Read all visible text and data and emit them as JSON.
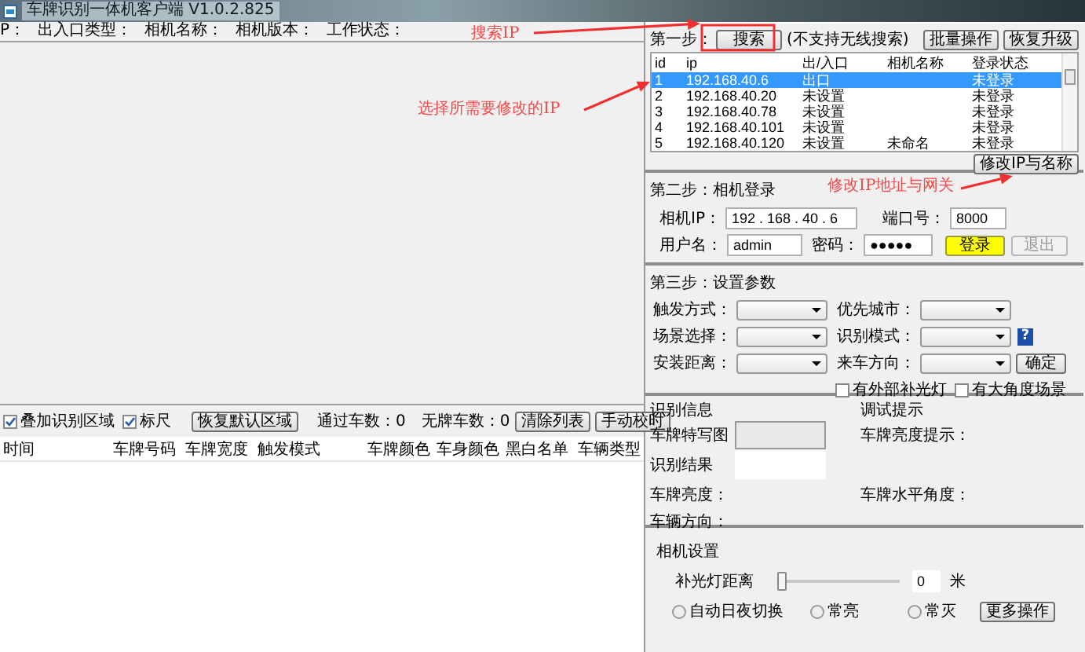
{
  "window": {
    "title": "车牌识别一体机客户端 V1.0.2.825"
  },
  "info_bar": [
    "P：",
    "出入口类型：",
    "相机名称：",
    "相机版本：",
    "工作状态："
  ],
  "left_toolbar": {
    "checkboxes": [
      {
        "label": "叠加识别区域",
        "checked": true
      },
      {
        "label": "标尺",
        "checked": true
      }
    ],
    "restore_button": "恢复默认区域",
    "passed_count": "通过车数：0",
    "unplated_count": "无牌车数：0",
    "buttons": [
      "清除列表",
      "手动校时"
    ]
  },
  "records_table": {
    "columns": [
      "时间",
      "车牌号码",
      "车牌宽度",
      "触发模式",
      "车牌颜色",
      "车身颜色",
      "黑白名单",
      "车辆类型"
    ]
  },
  "step1": {
    "label": "第一步：",
    "search_button": "搜索",
    "note": "(不支持无线搜索)",
    "buttons": [
      "批量操作",
      "恢复升级"
    ],
    "columns": [
      "id",
      "ip",
      "出/入口",
      "相机名称",
      "登录状态"
    ],
    "rows": [
      {
        "id": "1",
        "ip": "192.168.40.6",
        "gate": "出口",
        "status": "未登录",
        "selected": true
      },
      {
        "id": "2",
        "ip": "192.168.40.20",
        "gate": "未设置",
        "status": "未登录",
        "selected": false
      },
      {
        "id": "3",
        "ip": "192.168.40.78",
        "gate": "未设置",
        "status": "未登录",
        "selected": false
      },
      {
        "id": "4",
        "ip": "192.168.40.101",
        "gate": "未设置",
        "status": "未登录",
        "selected": false
      },
      {
        "id": "5",
        "ip": "192.168.40.120",
        "gate": "未设置",
        "name": "未命名",
        "status": "未登录",
        "selected": false
      }
    ],
    "modify_button": "修改IP与名称"
  },
  "step2": {
    "title": "第二步：相机登录",
    "ip_label": "相机IP：",
    "ip_value": "192 . 168 . 40 . 6",
    "port_label": "端口号：",
    "port": "8000",
    "user_label": "用户名：",
    "user": "admin",
    "password_label": "密码：",
    "password": "●●●●●",
    "login_button": "登录",
    "logout_button": {
      "label": "退出",
      "disabled": true
    }
  },
  "step3": {
    "title": "第三步：设置参数",
    "fields": [
      {
        "label": "触发方式："
      },
      {
        "label": "优先城市："
      },
      {
        "label": "场景选择："
      },
      {
        "label": "识别模式：",
        "help_icon": "?"
      },
      {
        "label": "安装距离："
      },
      {
        "label": "来车方向："
      }
    ],
    "confirm_button": "确定",
    "checkboxes": [
      {
        "label": "有外部补光灯",
        "checked": false
      },
      {
        "label": "有大角度场景",
        "checked": false
      }
    ]
  },
  "recognition": {
    "title": "识别信息",
    "plate_image_label": "车牌特写图",
    "result_label": "识别结果",
    "debug_title": "调试提示",
    "brightness_hint": "车牌亮度提示：",
    "brightness": "车牌亮度：",
    "angle": "车牌水平角度：",
    "direction": "车辆方向："
  },
  "camera": {
    "title": "相机设置",
    "distance_label": "补光灯距离",
    "level": 0,
    "distance_value": "0",
    "unit": "米",
    "radios": [
      {
        "label": "自动日夜切换",
        "selected": false
      },
      {
        "label": "常亮",
        "selected": false
      },
      {
        "label": "常灭",
        "selected": false
      }
    ],
    "more_button": "更多操作"
  },
  "annotations": [
    {
      "text": "搜索IP"
    },
    {
      "text": "选择所需要修改的IP"
    },
    {
      "text": "修改IP地址与网关"
    }
  ]
}
